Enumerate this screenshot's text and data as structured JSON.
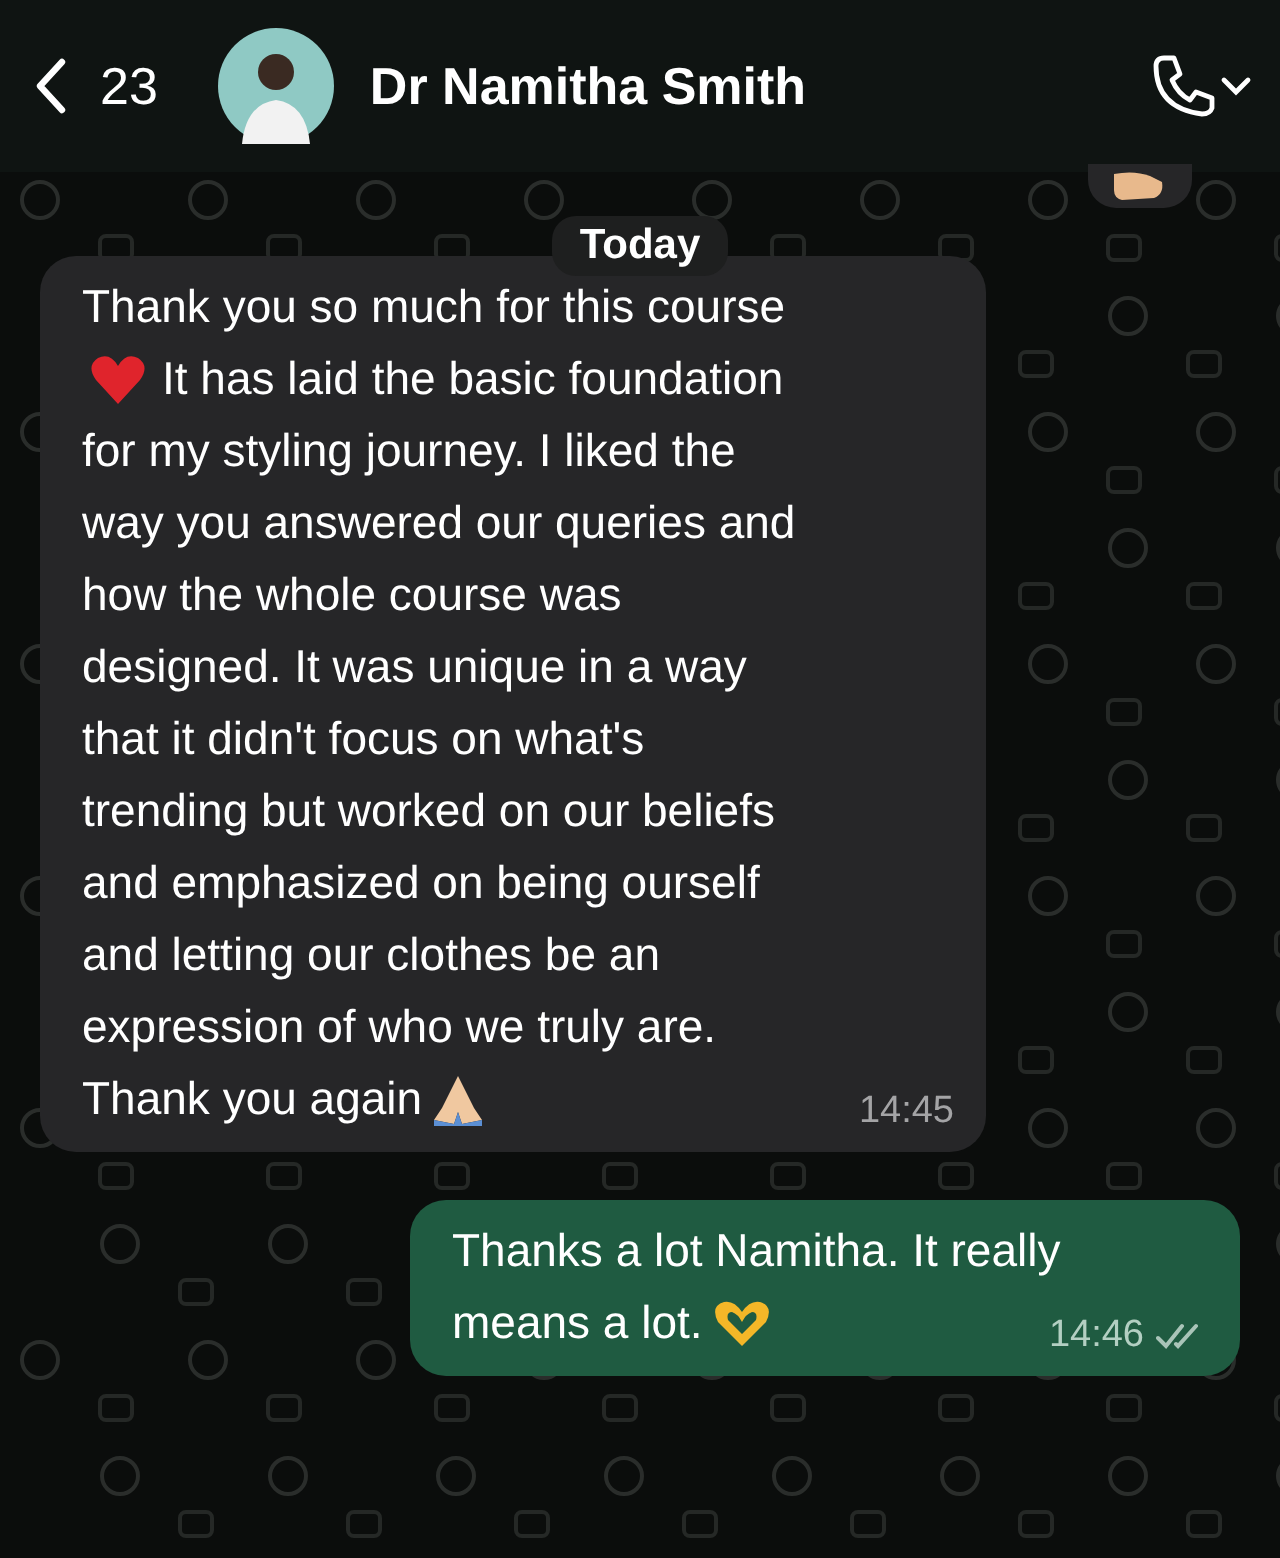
{
  "header": {
    "back_count": "23",
    "contact_name": "Dr Namitha Smith"
  },
  "date_divider": "Today",
  "messages": [
    {
      "kind": "incoming",
      "time": "14:45",
      "lines": [
        [
          {
            "kind": "text",
            "text": "Thank you so much for this course"
          }
        ],
        [
          {
            "kind": "heart"
          },
          {
            "kind": "text",
            "text": "It has laid the basic foundation"
          }
        ],
        [
          {
            "kind": "text",
            "text": "for my styling journey. I liked the"
          }
        ],
        [
          {
            "kind": "text",
            "text": "way you answered our queries and"
          }
        ],
        [
          {
            "kind": "text",
            "text": "how the whole course was"
          }
        ],
        [
          {
            "kind": "text",
            "text": "designed. It was unique in a way"
          }
        ],
        [
          {
            "kind": "text",
            "text": "that it didn't focus on what's"
          }
        ],
        [
          {
            "kind": "text",
            "text": "trending but worked on our beliefs"
          }
        ],
        [
          {
            "kind": "text",
            "text": "and emphasized on being ourself"
          }
        ],
        [
          {
            "kind": "text",
            "text": "and letting our clothes be an"
          }
        ],
        [
          {
            "kind": "text",
            "text": "expression of who we truly are."
          }
        ],
        [
          {
            "kind": "text",
            "text": "Thank you again"
          },
          {
            "kind": "pray"
          }
        ]
      ]
    },
    {
      "kind": "outgoing",
      "time": "14:46",
      "read": true,
      "lines": [
        [
          {
            "kind": "text",
            "text": "Thanks a lot Namitha. It really"
          }
        ],
        [
          {
            "kind": "text",
            "text": "means a lot."
          },
          {
            "kind": "hearthands"
          }
        ]
      ]
    }
  ]
}
